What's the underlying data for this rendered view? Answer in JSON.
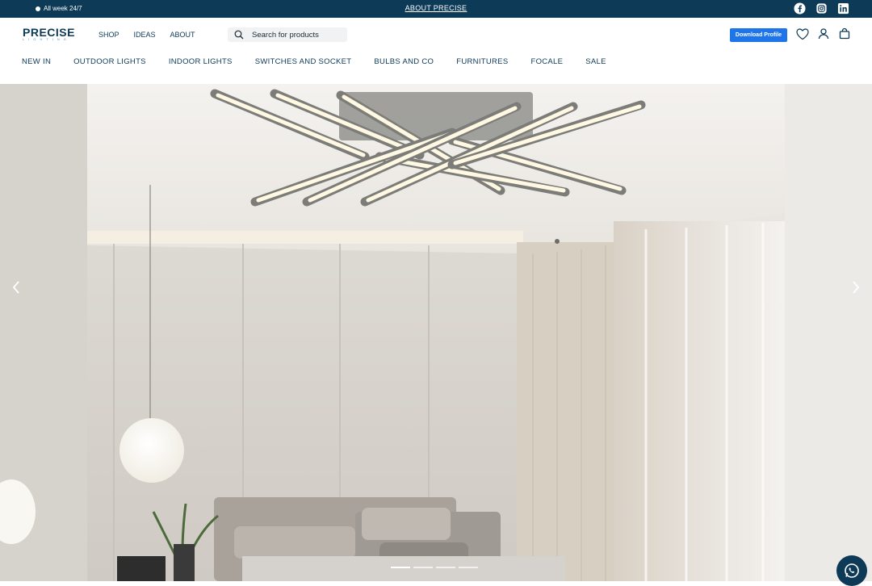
{
  "topbar": {
    "hours_text": "All week 24/7",
    "about_link": "ABOUT PRECISE",
    "social": [
      "facebook-icon",
      "instagram-icon",
      "linkedin-icon"
    ]
  },
  "header": {
    "logo_text": "PRECISE",
    "logo_sub": "LIGHTING",
    "nav": [
      "SHOP",
      "IDEAS",
      "ABOUT"
    ],
    "search_placeholder": "Search for products",
    "download_button": "Download Profile",
    "icons": [
      "heart-icon",
      "user-icon",
      "bag-icon"
    ]
  },
  "categories": [
    "NEW IN",
    "OUTDOOR LIGHTS",
    "INDOOR LIGHTS",
    "SWITCHES AND SOCKET",
    "BULBS AND CO",
    "FURNITURES",
    "FOCALE",
    "SALE"
  ],
  "hero": {
    "slides_count": 4,
    "active_slide": 1
  },
  "colors": {
    "brand_navy": "#0d3a56",
    "button_blue": "#1e74e9"
  }
}
